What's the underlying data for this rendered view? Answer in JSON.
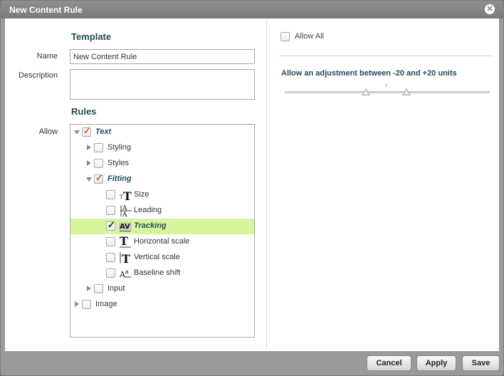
{
  "dialog": {
    "title": "New Content Rule",
    "close_icon": "close-icon"
  },
  "template": {
    "section_title": "Template",
    "name_label": "Name",
    "name_value": "New Content Rule",
    "description_label": "Description",
    "description_value": ""
  },
  "rules": {
    "section_title": "Rules",
    "allow_label": "Allow",
    "tree": [
      {
        "label": "Text",
        "checked": true,
        "expanded": true
      },
      {
        "label": "Styling",
        "checked": false,
        "expanded": false
      },
      {
        "label": "Styles",
        "checked": false,
        "expanded": false
      },
      {
        "label": "Fitting",
        "checked": true,
        "expanded": true
      },
      {
        "label": "Size",
        "checked": false,
        "icon": "type-size-icon"
      },
      {
        "label": "Leading",
        "checked": false,
        "icon": "leading-icon"
      },
      {
        "label": "Tracking",
        "checked": true,
        "selected": true,
        "icon": "tracking-icon"
      },
      {
        "label": "Horizontal scale",
        "checked": false,
        "icon": "horizontal-scale-icon"
      },
      {
        "label": "Vertical scale",
        "checked": false,
        "icon": "vertical-scale-icon"
      },
      {
        "label": "Baseline shift",
        "checked": false,
        "icon": "baseline-shift-icon"
      },
      {
        "label": "Input",
        "checked": false,
        "expanded": false
      },
      {
        "label": "Image",
        "checked": false,
        "expanded": false
      }
    ]
  },
  "adjustment": {
    "allow_all_label": "Allow All",
    "allow_all_checked": false,
    "description": "Allow an adjustment between -20 and +20 units",
    "min": -20,
    "max": 20
  },
  "footer": {
    "cancel_label": "Cancel",
    "apply_label": "Apply",
    "save_label": "Save"
  },
  "colors": {
    "selected_row": "#d7f59a",
    "check_accent": "#d8553a",
    "heading": "#254a5c"
  }
}
